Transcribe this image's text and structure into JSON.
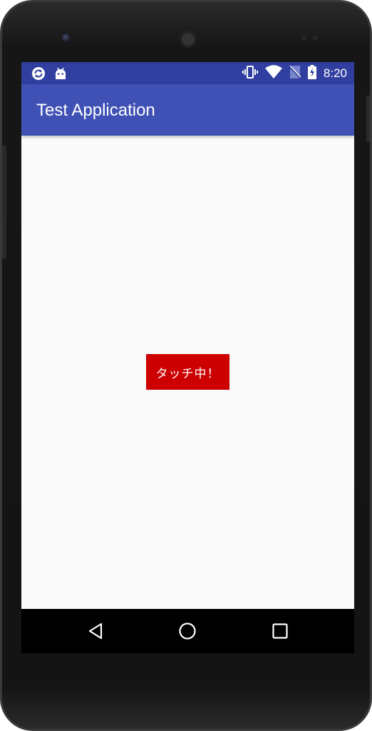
{
  "device": {
    "name": "phone-frame"
  },
  "status_bar": {
    "time": "8:20",
    "background": "#303f9f",
    "left_icons": [
      "sync-icon",
      "android-debug-icon"
    ],
    "right_icons": [
      "vibrate-icon",
      "wifi-icon",
      "no-sim-icon",
      "battery-charging-icon"
    ]
  },
  "app_bar": {
    "title": "Test Application",
    "background": "#3f51b5"
  },
  "content": {
    "background": "#fafafa",
    "touch_label": {
      "text": "タッチ中！",
      "background": "#cc0000"
    }
  },
  "nav_bar": {
    "buttons": [
      "back-icon",
      "home-icon",
      "recents-icon"
    ]
  }
}
